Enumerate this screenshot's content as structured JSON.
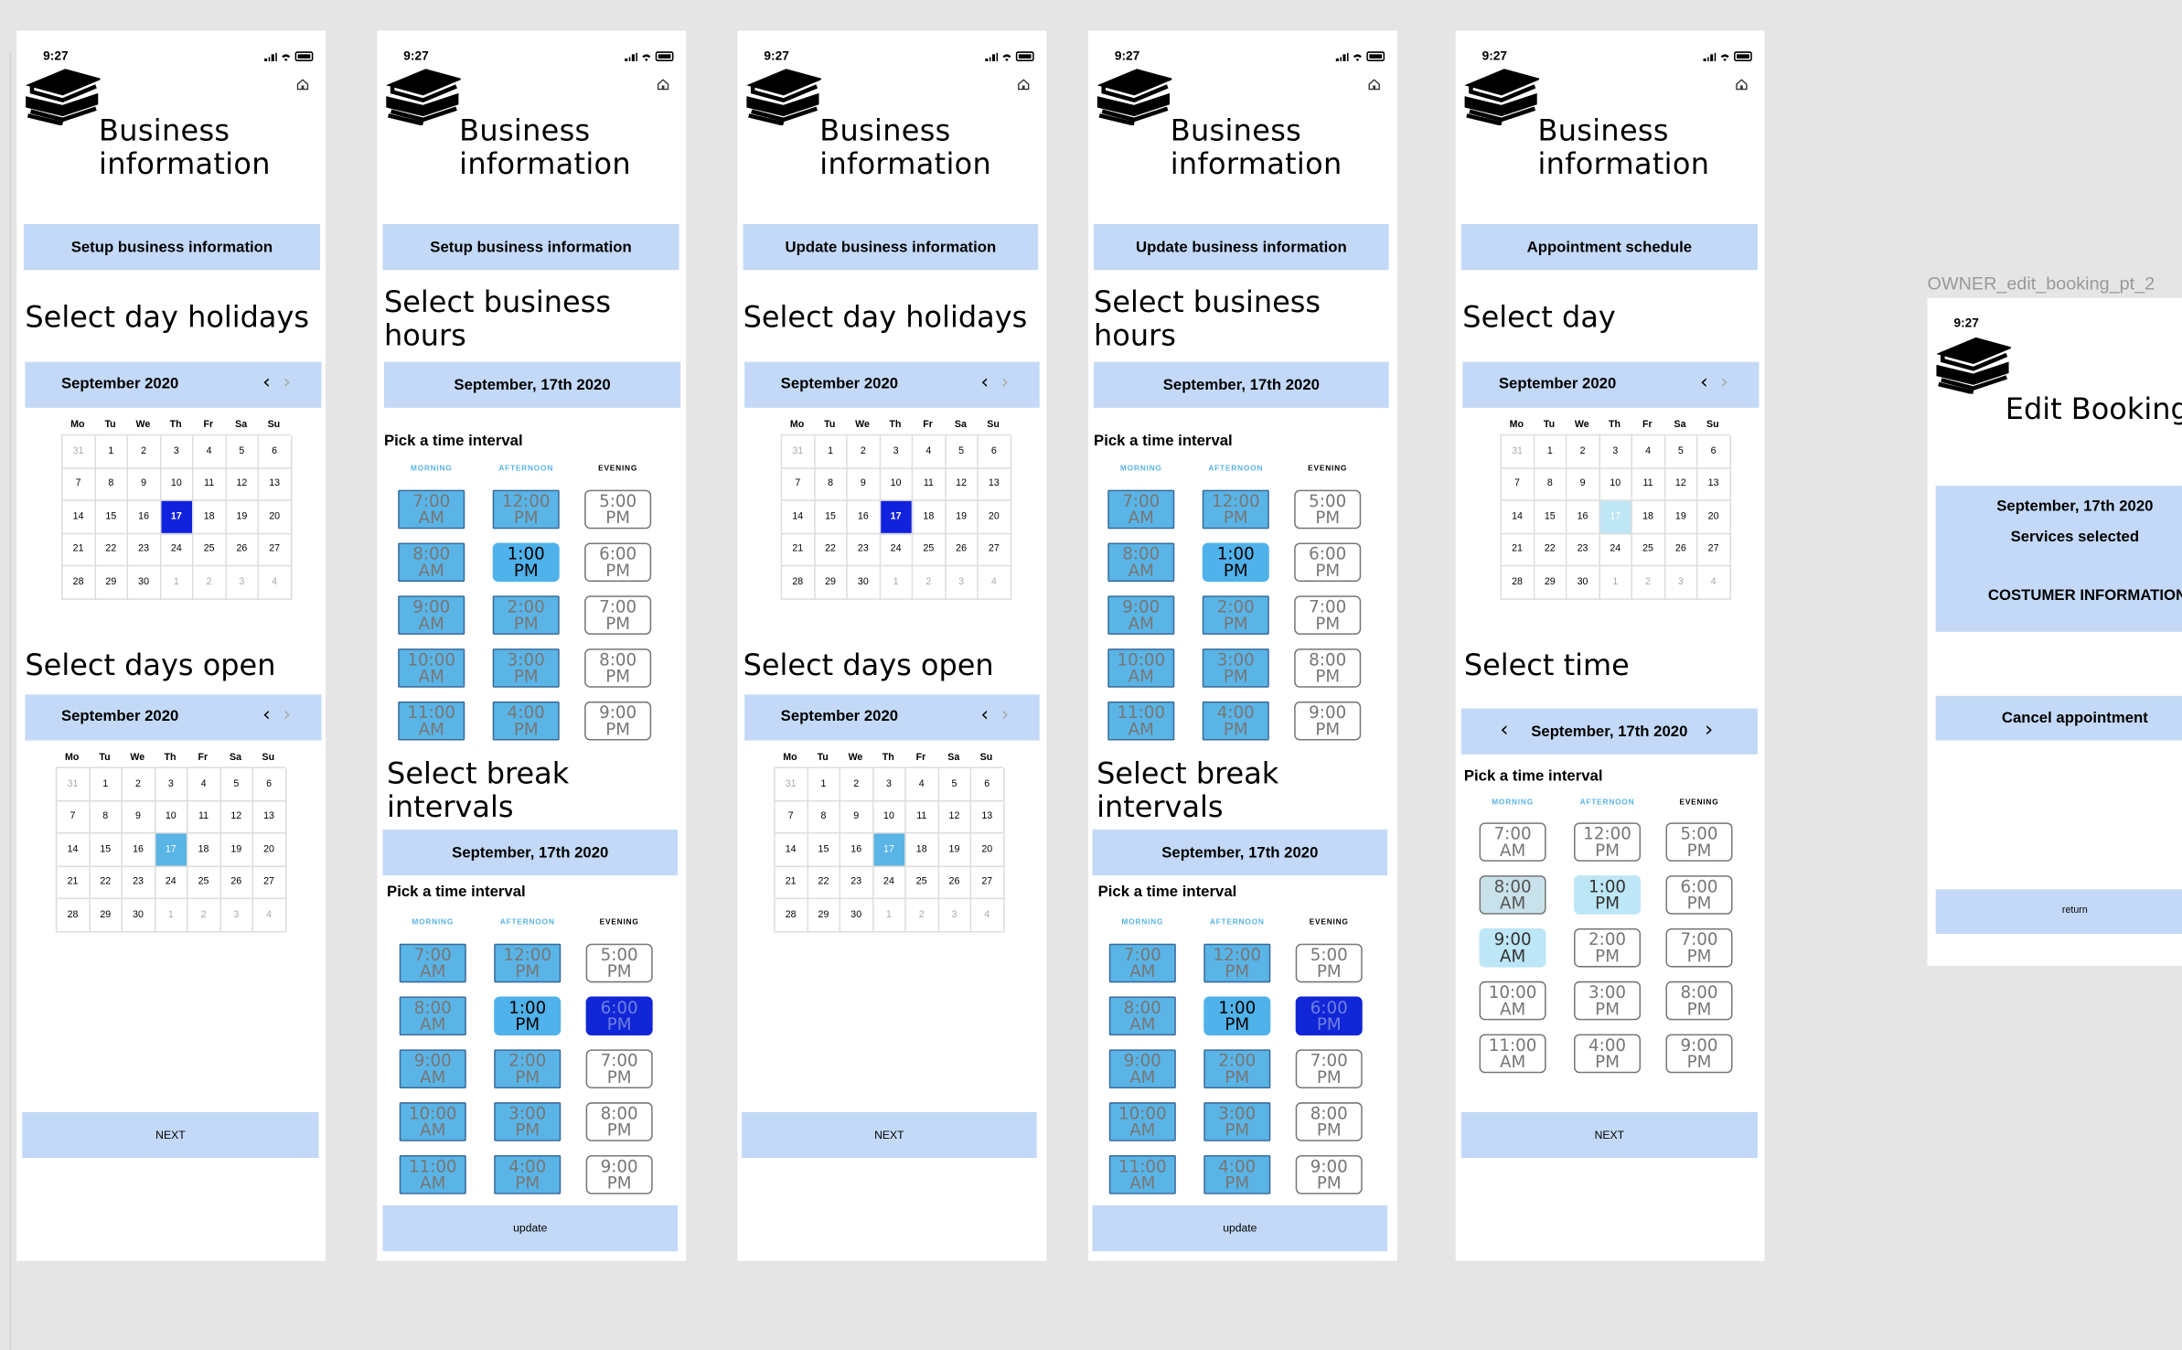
{
  "status_time": "9:27",
  "app_title_line1": "Business",
  "app_title_line2": "information",
  "weekdays": [
    "Mo",
    "Tu",
    "We",
    "Th",
    "Fr",
    "Sa",
    "Su"
  ],
  "calendar_days": [
    [
      "31",
      "1",
      "2",
      "3",
      "4",
      "5",
      "6"
    ],
    [
      "7",
      "8",
      "9",
      "10",
      "11",
      "12",
      "13"
    ],
    [
      "14",
      "15",
      "16",
      "17",
      "18",
      "19",
      "20"
    ],
    [
      "21",
      "22",
      "23",
      "24",
      "25",
      "26",
      "27"
    ],
    [
      "28",
      "29",
      "30",
      "1",
      "2",
      "3",
      "4"
    ]
  ],
  "labels": {
    "setup": "Setup business information",
    "update": "Update business information",
    "appointment": "Appointment schedule",
    "select_holidays": "Select day holidays",
    "select_open": "Select days open",
    "select_hours_1": "Select business",
    "select_hours_2": "hours",
    "select_break_1": "Select break",
    "select_break_2": "intervals",
    "select_day": "Select day",
    "select_time": "Select time",
    "month": "September 2020",
    "date_full": "September, 17th 2020",
    "pick_interval": "Pick a time interval",
    "morning": "MORNING",
    "afternoon": "AFTERNOON",
    "evening": "EVENING",
    "next": "NEXT",
    "update_btn": "update",
    "prev": "‹",
    "next_arrow": "›"
  },
  "time_slots": [
    [
      "7:00 AM",
      "12:00 PM",
      "5:00 PM"
    ],
    [
      "8:00 AM",
      "1:00 PM",
      "6:00 PM"
    ],
    [
      "9:00 AM",
      "2:00 PM",
      "7:00 PM"
    ],
    [
      "10:00 AM",
      "3:00 PM",
      "8:00 PM"
    ],
    [
      "11:00 AM",
      "4:00 PM",
      "9:00 PM"
    ]
  ],
  "edit": {
    "frame_label": "OWNER_edit_booking_pt_2",
    "title": "Edit Booking",
    "date": "September, 17th 2020",
    "services": "Services selected",
    "customer": "COSTUMER INFORMATION",
    "cancel": "Cancel appointment",
    "return": "return"
  },
  "colors": {
    "accent": "#c3d9f7",
    "selected": "#1122dd",
    "slot_on": "#5ab4e6",
    "slot_light": "#bde6f6"
  }
}
